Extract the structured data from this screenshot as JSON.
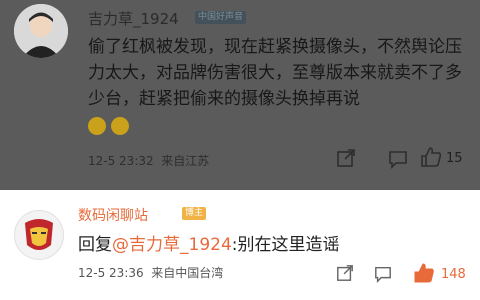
{
  "comments": [
    {
      "username": "吉力草_1924",
      "badge": "中国好声音",
      "text": "偷了红枫被发现，现在赶紧换摄像头，不然舆论压力太大，对品牌伤害很大，至尊版本来就卖不了多少台，赶紧把偷来的摄像头换掉再说",
      "emojis": [
        "grin-emoji",
        "grin-emoji"
      ],
      "time": "12-5 23:32",
      "location": "来自江苏",
      "likes": "15",
      "colors": {
        "bg": "#5b5b5b"
      }
    },
    {
      "username": "数码闲聊站",
      "badge": "博主",
      "reply_prefix": "回复",
      "mention": "@吉力草_1924",
      "text": ":别在这里造谣",
      "time": "12-5 23:36",
      "location": "来自中国台湾",
      "likes": "148",
      "colors": {
        "accent": "#e86a3a",
        "bg": "#ffffff"
      }
    }
  ]
}
